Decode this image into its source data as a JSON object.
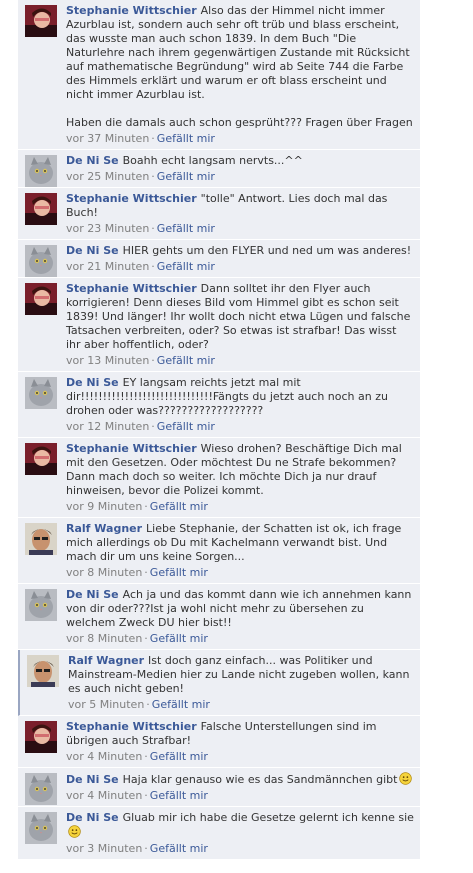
{
  "like_label": "Gefällt mir",
  "separator": "·",
  "comments": [
    {
      "author": "Stephanie Wittschier",
      "avatar": "avatar-stephanie-photo",
      "text": "Also das der Himmel nicht immer Azurblau ist, sondern auch sehr oft trüb und blass erscheint, das wusste man auch schon 1839. In dem Buch \"Die Naturlehre nach ihrem gegenwärtigen Zustande mit Rücksicht auf mathematische Begründung\" wird ab Seite 744 die Farbe des Himmels erklärt und warum er oft blass erscheint und nicht immer Azurblau ist.\n\nHaben die damals auch schon gesprüht??? Fragen über Fragen",
      "time": "vor 37 Minuten"
    },
    {
      "author": "De Ni Se",
      "avatar": "avatar-cat-photo",
      "text": "Boahh echt langsam nervts...^^",
      "time": "vor 25 Minuten"
    },
    {
      "author": "Stephanie Wittschier",
      "avatar": "avatar-stephanie-photo",
      "text": "\"tolle\" Antwort. Lies doch mal das Buch!",
      "time": "vor 23 Minuten"
    },
    {
      "author": "De Ni Se",
      "avatar": "avatar-cat-photo",
      "text": "HIER gehts um den FLYER und ned um was anderes!",
      "time": "vor 21 Minuten"
    },
    {
      "author": "Stephanie Wittschier",
      "avatar": "avatar-stephanie-photo",
      "text": "Dann solltet ihr den Flyer auch korrigieren! Denn dieses Bild vom Himmel gibt es schon seit 1839! Und länger! Ihr wollt doch nicht etwa Lügen und falsche Tatsachen verbreiten, oder? So etwas ist strafbar! Das wisst ihr aber hoffentlich, oder?",
      "time": "vor 13 Minuten"
    },
    {
      "author": "De Ni Se",
      "avatar": "avatar-cat-photo",
      "text": "EY langsam reichts jetzt mal mit dir!!!!!!!!!!!!!!!!!!!!!!!!!!!!!!Fängts du jetzt auch noch an zu drohen oder was??????????????????",
      "time": "vor 12 Minuten"
    },
    {
      "author": "Stephanie Wittschier",
      "avatar": "avatar-stephanie-photo",
      "text": "Wieso drohen? Beschäftige Dich mal mit den Gesetzen. Oder möchtest Du ne Strafe bekommen? Dann mach doch so weiter. Ich möchte Dich ja nur drauf hinweisen, bevor die Polizei kommt.",
      "time": "vor 9 Minuten"
    },
    {
      "author": "Ralf Wagner",
      "avatar": "avatar-ralf-photo",
      "text": "Liebe Stephanie, der Schatten ist ok, ich frage mich allerdings ob Du mit Kachelmann verwandt bist. Und mach dir um uns keine Sorgen...",
      "time": "vor 8 Minuten"
    },
    {
      "author": "De Ni Se",
      "avatar": "avatar-cat-photo",
      "text": "Ach ja und das kommt dann wie ich annehmen kann von dir oder???Ist ja wohl nicht mehr zu übersehen zu welchem Zweck DU hier bist!!",
      "time": "vor 8 Minuten"
    },
    {
      "author": "Ralf Wagner",
      "avatar": "avatar-ralf-photo",
      "text": "Ist doch ganz einfach... was Politiker und Mainstream-Medien hier zu Lande nicht zugeben wollen, kann es auch nicht geben!",
      "time": "vor 5 Minuten",
      "highlight": true
    },
    {
      "author": "Stephanie Wittschier",
      "avatar": "avatar-stephanie-photo",
      "text": "Falsche Unterstellungen sind im übrigen auch Strafbar!",
      "time": "vor 4 Minuten"
    },
    {
      "author": "De Ni Se",
      "avatar": "avatar-cat-photo",
      "text": "Haja klar genauso wie es das Sandmännchen gibt",
      "emoji": "smiley-icon",
      "time": "vor 4 Minuten"
    },
    {
      "author": "De Ni Se",
      "avatar": "avatar-cat-photo",
      "text": "Gluab mir ich habe die Gesetze gelernt ich kenne sie",
      "emoji": "smiley-icon",
      "time": "vor 3 Minuten"
    }
  ]
}
